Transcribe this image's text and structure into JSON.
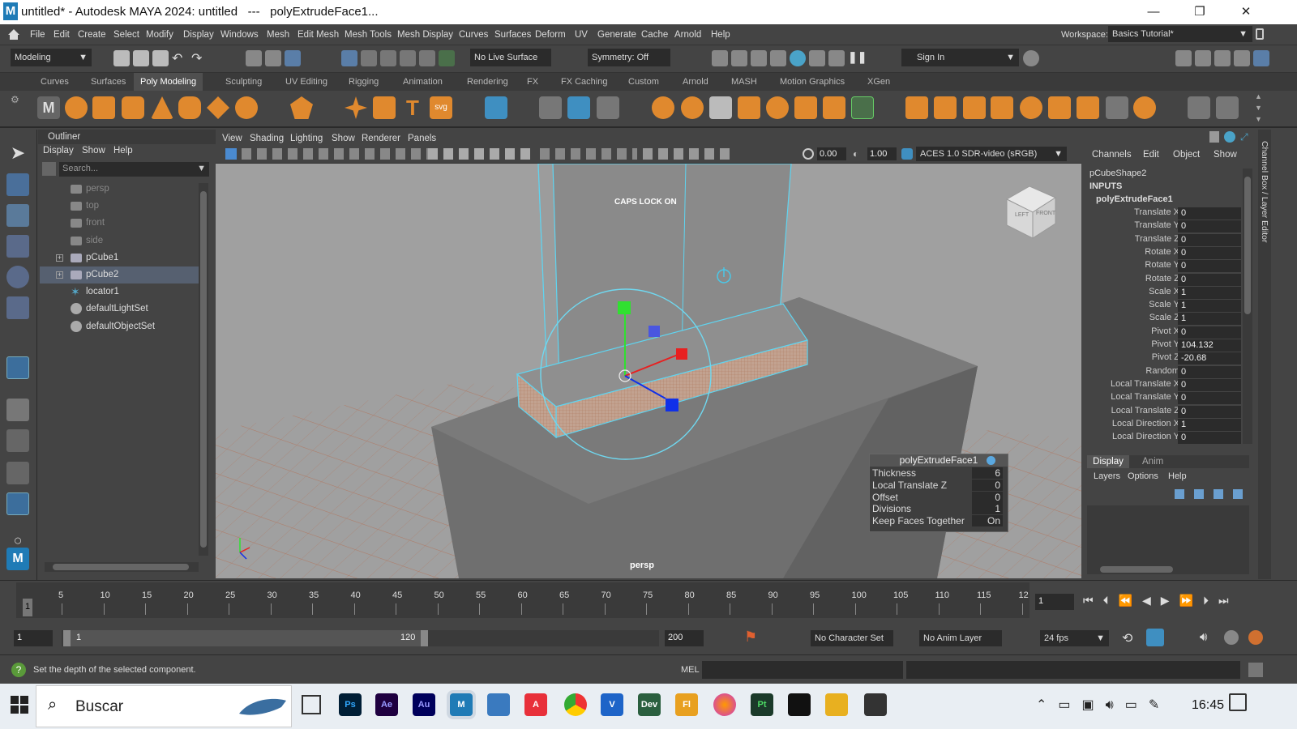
{
  "title_bar": {
    "title": "untitled* - Autodesk MAYA 2024: untitled   ---   polyExtrudeFace1...",
    "app_logo": "M",
    "minimize": "—",
    "restore": "❐",
    "close": "✕"
  },
  "menu": [
    "File",
    "Edit",
    "Create",
    "Select",
    "Modify",
    "Display",
    "Windows",
    "Mesh",
    "Edit Mesh",
    "Mesh Tools",
    "Mesh Display",
    "Curves",
    "Surfaces",
    "Deform",
    "UV",
    "Generate",
    "Cache",
    "Arnold",
    "Help"
  ],
  "workspace": {
    "label": "Workspace:",
    "value": "Basics Tutorial*"
  },
  "status_line": {
    "menuset": "Modeling",
    "live_surface": "No Live Surface",
    "symmetry": "Symmetry: Off",
    "sign_in": "Sign In"
  },
  "shelf_tabs": [
    "Curves",
    "Surfaces",
    "Poly Modeling",
    "Sculpting",
    "UV Editing",
    "Rigging",
    "Animation",
    "Rendering",
    "FX",
    "FX Caching",
    "Custom",
    "Arnold",
    "MASH",
    "Motion Graphics",
    "XGen"
  ],
  "active_shelf": "Poly Modeling",
  "outliner": {
    "title": "Outliner",
    "menu": [
      "Display",
      "Show",
      "Help"
    ],
    "search_placeholder": "Search...",
    "items": [
      {
        "label": "persp",
        "dim": true
      },
      {
        "label": "top",
        "dim": true
      },
      {
        "label": "front",
        "dim": true
      },
      {
        "label": "side",
        "dim": true
      },
      {
        "label": "pCube1",
        "expand": true
      },
      {
        "label": "pCube2",
        "expand": true,
        "selected": true
      },
      {
        "label": "locator1"
      },
      {
        "label": "defaultLightSet"
      },
      {
        "label": "defaultObjectSet"
      }
    ]
  },
  "viewport": {
    "menu": [
      "View",
      "Shading",
      "Lighting",
      "Show",
      "Renderer",
      "Panels"
    ],
    "exposure": "0.00",
    "gamma": "1.00",
    "color_space": "ACES 1.0 SDR-video (sRGB)",
    "caps_lock": "CAPS LOCK ON",
    "camera_label": "persp",
    "cube_left": "LEFT",
    "cube_front": "FRONT"
  },
  "extrude_panel": {
    "title": "polyExtrudeFace1",
    "rows": [
      {
        "label": "Thickness",
        "value": "6"
      },
      {
        "label": "Local Translate Z",
        "value": "0"
      },
      {
        "label": "Offset",
        "value": "0"
      },
      {
        "label": "Divisions",
        "value": "1"
      },
      {
        "label": "Keep Faces Together",
        "value": "On"
      }
    ]
  },
  "channel_box": {
    "menu": [
      "Channels",
      "Edit",
      "Object",
      "Show"
    ],
    "shape": "pCubeShape2",
    "inputs": "INPUTS",
    "node": "polyExtrudeFace1",
    "attrs": [
      {
        "label": "Translate X",
        "value": "0"
      },
      {
        "label": "Translate Y",
        "value": "0"
      },
      {
        "label": "Translate Z",
        "value": "0"
      },
      {
        "label": "Rotate X",
        "value": "0"
      },
      {
        "label": "Rotate Y",
        "value": "0"
      },
      {
        "label": "Rotate Z",
        "value": "0"
      },
      {
        "label": "Scale X",
        "value": "1"
      },
      {
        "label": "Scale Y",
        "value": "1"
      },
      {
        "label": "Scale Z",
        "value": "1"
      },
      {
        "label": "Pivot X",
        "value": "0"
      },
      {
        "label": "Pivot Y",
        "value": "104.132"
      },
      {
        "label": "Pivot Z",
        "value": "-20.68"
      },
      {
        "label": "Random",
        "value": "0"
      },
      {
        "label": "Local Translate X",
        "value": "0"
      },
      {
        "label": "Local Translate Y",
        "value": "0"
      },
      {
        "label": "Local Translate Z",
        "value": "0"
      },
      {
        "label": "Local Direction X",
        "value": "1"
      },
      {
        "label": "Local Direction Y",
        "value": "0"
      }
    ],
    "layer_tabs": [
      "Display",
      "Anim"
    ],
    "layer_menu": [
      "Layers",
      "Options",
      "Help"
    ],
    "side_label": "Channel Box / Layer Editor"
  },
  "timeline": {
    "ticks": [
      "5",
      "10",
      "15",
      "20",
      "25",
      "30",
      "35",
      "40",
      "45",
      "50",
      "55",
      "60",
      "65",
      "70",
      "75",
      "80",
      "85",
      "90",
      "95",
      "100",
      "105",
      "110",
      "115",
      "12"
    ],
    "current_frame_marker": "1",
    "current_frame": "1"
  },
  "range": {
    "start": "1",
    "inner_start": "1",
    "inner_end": "120",
    "end": "200",
    "character_set": "No Character Set",
    "anim_layer": "No Anim Layer",
    "fps": "24 fps"
  },
  "help_line": {
    "text": "Set the depth of the selected component.",
    "mel": "MEL"
  },
  "taskbar": {
    "search": "Buscar",
    "time": "16:45",
    "apps": [
      "Ps",
      "Ae",
      "Au",
      "M",
      "Cal",
      "A",
      "Chrome",
      "V",
      "Dev",
      "Fl",
      "Firefox",
      "Pt",
      "TikTok",
      "Folder",
      "Clap"
    ]
  }
}
